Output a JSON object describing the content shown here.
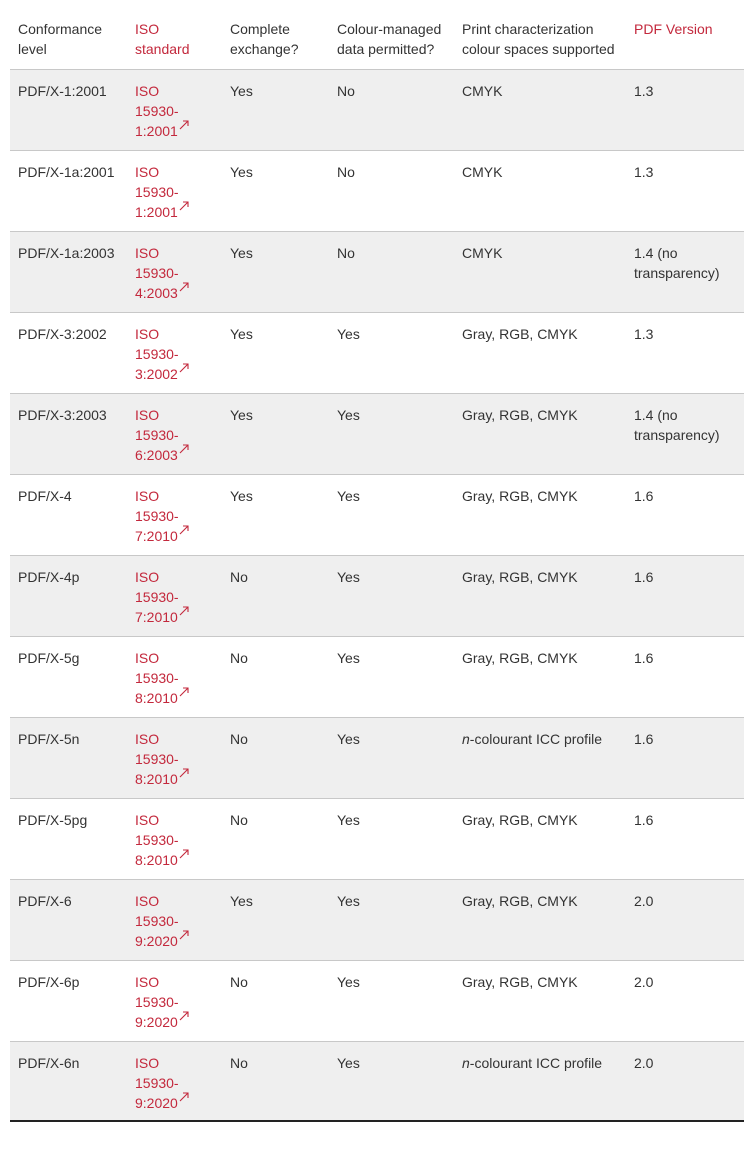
{
  "headers": {
    "level": "Conformance level",
    "standard": "ISO standard",
    "exchange": "Complete exchange?",
    "colour_managed": "Colour-managed data permitted?",
    "print_spaces": "Print characterization colour spaces supported",
    "pdf_version": "PDF Version"
  },
  "icons": {
    "external_link": "external-link-icon"
  },
  "colors": {
    "accent": "#c3283c",
    "stripe": "#efefef",
    "rule": "#c8c8c8"
  },
  "rows": [
    {
      "level": "PDF/X-1:2001",
      "std_a": "ISO",
      "std_b": "15930-",
      "std_c": "1:2001",
      "exchange": "Yes",
      "colour": "No",
      "spaces": "CMYK",
      "spaces_prefix": "",
      "version": "1.3"
    },
    {
      "level": "PDF/X-1a:2001",
      "std_a": "ISO",
      "std_b": "15930-",
      "std_c": "1:2001",
      "exchange": "Yes",
      "colour": "No",
      "spaces": "CMYK",
      "spaces_prefix": "",
      "version": "1.3"
    },
    {
      "level": "PDF/X-1a:2003",
      "std_a": "ISO",
      "std_b": "15930-",
      "std_c": "4:2003",
      "exchange": "Yes",
      "colour": "No",
      "spaces": "CMYK",
      "spaces_prefix": "",
      "version": "1.4 (no transparency)"
    },
    {
      "level": "PDF/X-3:2002",
      "std_a": "ISO",
      "std_b": "15930-",
      "std_c": "3:2002",
      "exchange": "Yes",
      "colour": "Yes",
      "spaces": "Gray, RGB, CMYK",
      "spaces_prefix": "",
      "version": "1.3"
    },
    {
      "level": "PDF/X-3:2003",
      "std_a": "ISO",
      "std_b": "15930-",
      "std_c": "6:2003",
      "exchange": "Yes",
      "colour": "Yes",
      "spaces": "Gray, RGB, CMYK",
      "spaces_prefix": "",
      "version": "1.4 (no transparency)"
    },
    {
      "level": "PDF/X-4",
      "std_a": "ISO",
      "std_b": "15930-",
      "std_c": "7:2010",
      "exchange": "Yes",
      "colour": "Yes",
      "spaces": "Gray, RGB, CMYK",
      "spaces_prefix": "",
      "version": "1.6"
    },
    {
      "level": "PDF/X-4p",
      "std_a": "ISO",
      "std_b": "15930-",
      "std_c": "7:2010",
      "exchange": "No",
      "colour": "Yes",
      "spaces": "Gray, RGB, CMYK",
      "spaces_prefix": "",
      "version": "1.6"
    },
    {
      "level": "PDF/X-5g",
      "std_a": "ISO",
      "std_b": "15930-",
      "std_c": "8:2010",
      "exchange": "No",
      "colour": "Yes",
      "spaces": "Gray, RGB, CMYK",
      "spaces_prefix": "",
      "version": "1.6"
    },
    {
      "level": "PDF/X-5n",
      "std_a": "ISO",
      "std_b": "15930-",
      "std_c": "8:2010",
      "exchange": "No",
      "colour": "Yes",
      "spaces": "-colourant ICC profile",
      "spaces_prefix": "n",
      "version": "1.6"
    },
    {
      "level": "PDF/X-5pg",
      "std_a": "ISO",
      "std_b": "15930-",
      "std_c": "8:2010",
      "exchange": "No",
      "colour": "Yes",
      "spaces": "Gray, RGB, CMYK",
      "spaces_prefix": "",
      "version": "1.6"
    },
    {
      "level": "PDF/X-6",
      "std_a": "ISO",
      "std_b": "15930-",
      "std_c": "9:2020",
      "exchange": "Yes",
      "colour": "Yes",
      "spaces": "Gray, RGB, CMYK",
      "spaces_prefix": "",
      "version": "2.0"
    },
    {
      "level": "PDF/X-6p",
      "std_a": "ISO",
      "std_b": "15930-",
      "std_c": "9:2020",
      "exchange": "No",
      "colour": "Yes",
      "spaces": "Gray, RGB, CMYK",
      "spaces_prefix": "",
      "version": "2.0"
    },
    {
      "level": "PDF/X-6n",
      "std_a": "ISO",
      "std_b": "15930-",
      "std_c": "9:2020",
      "exchange": "No",
      "colour": "Yes",
      "spaces": "-colourant ICC profile",
      "spaces_prefix": "n",
      "version": "2.0"
    }
  ]
}
